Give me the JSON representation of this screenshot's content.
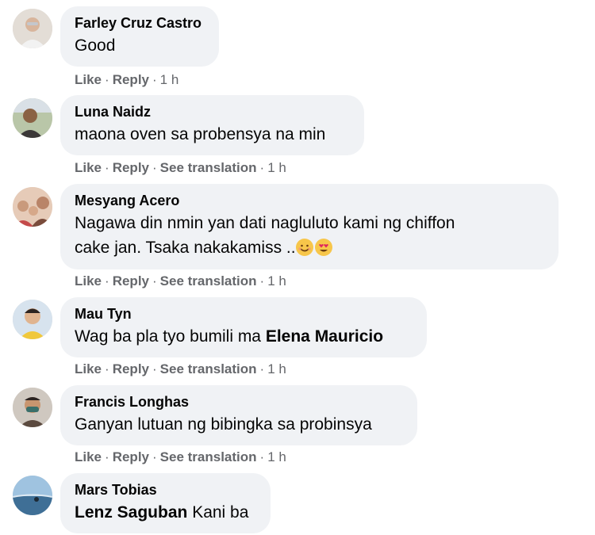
{
  "comments": [
    {
      "author": "Farley Cruz Castro",
      "text": "Good",
      "actions": {
        "like": "Like",
        "reply": "Reply",
        "time": "1 h"
      },
      "avatar_icon": "person-photo-icon"
    },
    {
      "author": "Luna Naidz",
      "text": "maona oven sa probensya na min",
      "actions": {
        "like": "Like",
        "reply": "Reply",
        "translate": "See translation",
        "time": "1 h"
      },
      "avatar_icon": "person-photo-icon"
    },
    {
      "author": "Mesyang Acero",
      "text_line1": "Nagawa din nmin yan dati nagluluto kami ng chiffon",
      "text_line2": "cake jan. Tsaka nakakamiss ..",
      "emojis": [
        "smiling-face-icon",
        "heart-eyes-face-icon"
      ],
      "actions": {
        "like": "Like",
        "reply": "Reply",
        "translate": "See translation",
        "time": "1 h"
      },
      "avatar_icon": "group-photo-icon"
    },
    {
      "author": "Mau Tyn",
      "text": "Wag ba pla tyo bumili ma ",
      "mention": "Elena Mauricio",
      "actions": {
        "like": "Like",
        "reply": "Reply",
        "translate": "See translation",
        "time": "1 h"
      },
      "avatar_icon": "person-photo-icon"
    },
    {
      "author": "Francis Longhas",
      "text": "Ganyan lutuan ng bibingka sa probinsya",
      "actions": {
        "like": "Like",
        "reply": "Reply",
        "translate": "See translation",
        "time": "1 h"
      },
      "avatar_icon": "person-photo-icon"
    },
    {
      "author": "Mars Tobias",
      "mention": "Lenz Saguban",
      "text": " Kani ba",
      "avatar_icon": "landscape-photo-icon"
    }
  ],
  "separator": "·",
  "colors": {
    "bubble": "#f0f2f5",
    "text": "#050505",
    "meta": "#65676b"
  }
}
